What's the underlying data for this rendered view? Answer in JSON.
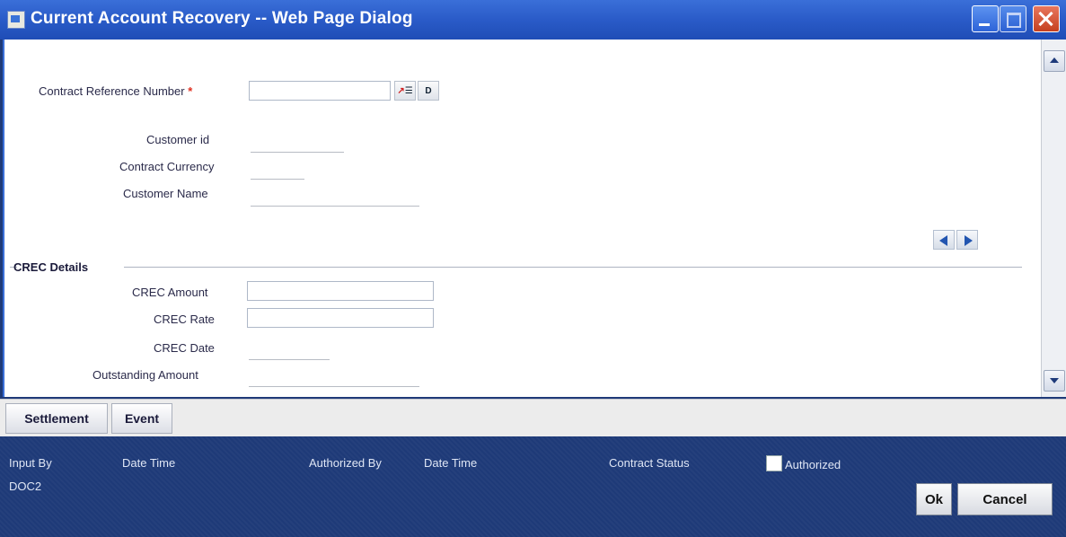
{
  "window": {
    "title": "Current Account Recovery -- Web Page Dialog"
  },
  "fields": {
    "contract_ref_label": "Contract Reference Number",
    "required_mark": "*",
    "contract_ref_value": "",
    "customer_id_label": "Customer id",
    "contract_currency_label": "Contract Currency",
    "customer_name_label": "Customer Name"
  },
  "crec": {
    "section_title": "CREC Details",
    "amount_label": "CREC Amount",
    "rate_label": "CREC Rate",
    "date_label": "CREC Date",
    "outstanding_label": "Outstanding Amount"
  },
  "tabs": [
    "Settlement",
    "Event"
  ],
  "footer": {
    "input_by": "Input By",
    "input_by_value": "DOC2",
    "date_time_1": "Date Time",
    "authorized_by": "Authorized By",
    "date_time_2": "Date Time",
    "contract_status": "Contract Status",
    "authorized": "Authorized",
    "ok_label": "Ok",
    "cancel_label": "Cancel"
  },
  "icons": {
    "lov": "list-of-values-icon",
    "d": "d-button-icon"
  }
}
